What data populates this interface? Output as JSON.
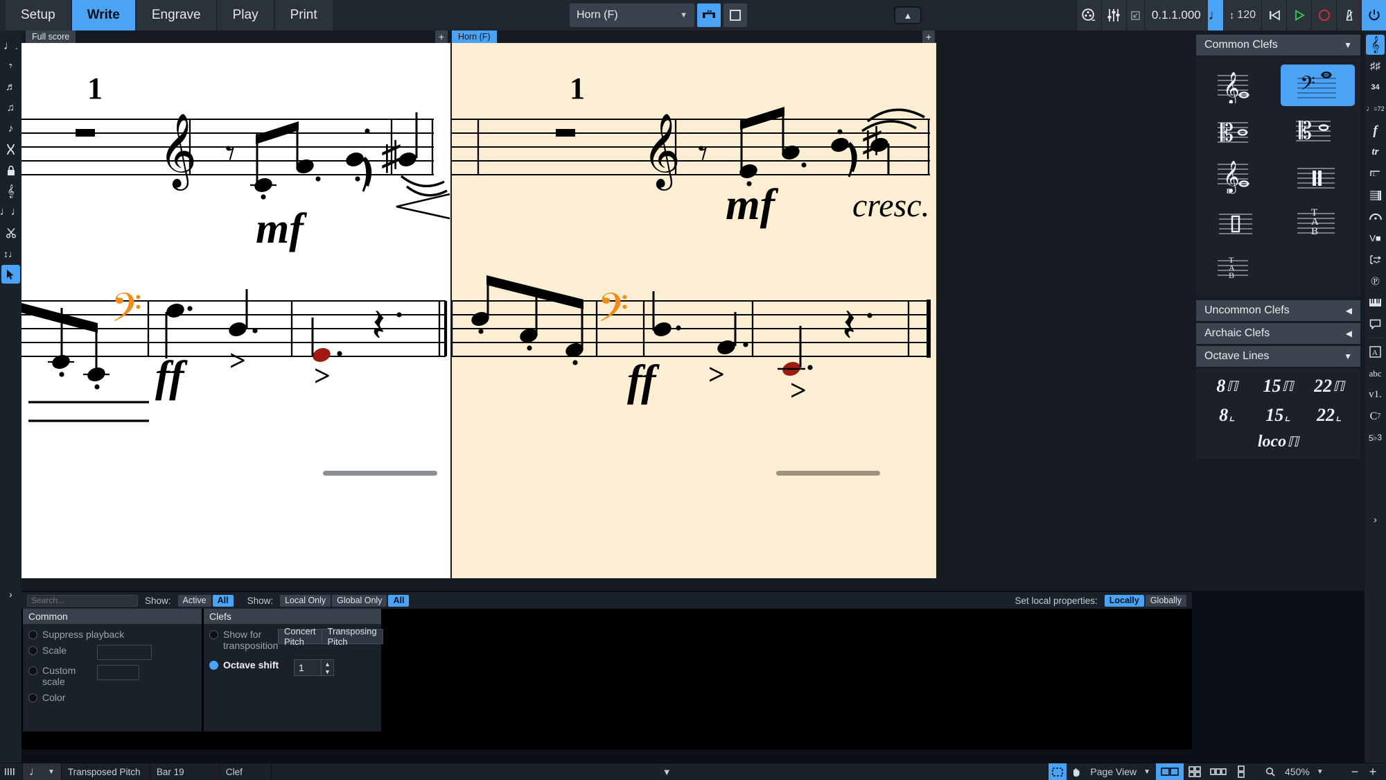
{
  "app": {
    "modes": [
      {
        "id": "setup",
        "label": "Setup",
        "active": false
      },
      {
        "id": "write",
        "label": "Write",
        "active": true
      },
      {
        "id": "engrave",
        "label": "Engrave",
        "active": false
      },
      {
        "id": "play",
        "label": "Play",
        "active": false
      },
      {
        "id": "print",
        "label": "Print",
        "active": false
      }
    ]
  },
  "toolbar": {
    "layout_select_value": "Horn (F)",
    "galley_view_icon": "galley-view-icon",
    "page_view_icon": "page-view-icon",
    "collapse_toolbar_icon": "chevron-up-icon",
    "mixer_icon": "mixer-icon",
    "video_icon": "film-reel-icon",
    "transport_position": "0.1.1.000",
    "tempo_note_icon": "quarter-note-icon",
    "tempo_value": "120",
    "rewind_icon": "rewind-to-start-icon",
    "play_icon": "play-icon",
    "record_icon": "record-icon",
    "metronome_icon": "metronome-icon",
    "power_icon": "power-icon"
  },
  "left_toolbar": {
    "items": [
      {
        "id": "note-durations",
        "icon": "dotted-quarter-note-icon",
        "active": false
      },
      {
        "id": "rests",
        "icon": "eighth-rest-icon",
        "active": false
      },
      {
        "id": "note-tools",
        "icon": "grace-note-icon",
        "active": false
      },
      {
        "id": "tuplets",
        "icon": "tuplet-icon",
        "active": false
      },
      {
        "id": "ornaments",
        "icon": "ornament-note-icon",
        "active": false
      },
      {
        "id": "slur-tool",
        "icon": "hourglass-icon",
        "active": false
      },
      {
        "id": "lock-duration",
        "icon": "lock-icon",
        "active": false
      },
      {
        "id": "insert-mode",
        "icon": "insert-clef-icon",
        "active": false
      },
      {
        "id": "rhythmic-grid",
        "icon": "two-notes-icon",
        "active": false
      },
      {
        "id": "cut-tool",
        "icon": "scissors-icon",
        "active": false
      },
      {
        "id": "transpose-tool",
        "icon": "transpose-note-icon",
        "active": false
      },
      {
        "id": "select-tool",
        "icon": "arrow-cursor-icon",
        "active": true
      }
    ],
    "expand_icon": "chevron-right-icon"
  },
  "right_toolbar": {
    "items": [
      {
        "id": "clefs-panel",
        "icon": "treble-clef-icon",
        "active": true
      },
      {
        "id": "key-signatures-panel",
        "icon": "double-sharp-icon",
        "active": false
      },
      {
        "id": "time-signatures-panel",
        "icon": "time-signature-icon",
        "active": false
      },
      {
        "id": "tempo-panel",
        "icon": "tempo-mark-icon",
        "active": false
      },
      {
        "id": "dynamics-panel",
        "icon": "forte-icon",
        "active": false
      },
      {
        "id": "ornaments-panel",
        "icon": "trill-icon",
        "active": false
      },
      {
        "id": "repeats-panel",
        "icon": "first-ending-icon",
        "active": false
      },
      {
        "id": "barlines-panel",
        "icon": "barlines-icon",
        "active": false
      },
      {
        "id": "holds-pauses-panel",
        "icon": "fermata-icon",
        "active": false
      },
      {
        "id": "playing-techniques-panel",
        "icon": "bowing-icon",
        "active": false
      },
      {
        "id": "lines-panel",
        "icon": "line-icon",
        "active": false
      },
      {
        "id": "pedal-lines-panel",
        "icon": "pedal-icon",
        "active": false
      },
      {
        "id": "tracks-panel",
        "icon": "keyboard-icon",
        "active": false
      },
      {
        "id": "comments-panel",
        "icon": "comment-icon",
        "active": false
      },
      {
        "id": "text-panel",
        "icon": "boxed-a-icon",
        "active": false
      },
      {
        "id": "lyrics-panel",
        "icon": "abc-icon",
        "active": false
      },
      {
        "id": "voices-panel",
        "icon": "v1-icon",
        "active": false
      },
      {
        "id": "chord-symbols-panel",
        "icon": "c7-icon",
        "active": false
      },
      {
        "id": "figured-bass-panel",
        "icon": "figured-bass-icon",
        "active": false
      }
    ]
  },
  "tabs": {
    "left": {
      "label": "Full score",
      "active": false
    },
    "right": {
      "label": "Horn (F)",
      "active": true
    },
    "add_label": "+"
  },
  "score": {
    "left_page": {
      "bar_number": "1",
      "systems": [
        {
          "clef": "treble",
          "dynamics": "mf",
          "marks": [
            "bar-rest",
            "eighth-rest",
            "hairpin-crescendo",
            "slur",
            "sharp"
          ]
        },
        {
          "clef": "bass",
          "clef_color": "#f28c18",
          "dynamics": "ff",
          "accent_marks": ">",
          "selected_note_color": "#9e1b14"
        }
      ]
    },
    "right_page": {
      "bar_number": "1",
      "systems": [
        {
          "clef": "treble",
          "dynamics": "mf",
          "text": "cresc.",
          "marks": [
            "bar-rest",
            "eighth-rest",
            "slur",
            "sharp"
          ]
        },
        {
          "clef": "bass",
          "clef_color": "#f28c18",
          "dynamics": "ff",
          "accent_marks": ">",
          "selected_note_color": "#9e1b14"
        }
      ]
    }
  },
  "right_panel": {
    "sections": [
      {
        "id": "common-clefs",
        "title": "Common Clefs",
        "expanded": true,
        "chevron": "chevron-down-icon"
      },
      {
        "id": "uncommon-clefs",
        "title": "Uncommon Clefs",
        "expanded": false,
        "chevron": "chevron-left-icon"
      },
      {
        "id": "archaic-clefs",
        "title": "Archaic Clefs",
        "expanded": false,
        "chevron": "chevron-left-icon"
      },
      {
        "id": "octave-lines",
        "title": "Octave Lines",
        "expanded": true,
        "chevron": "chevron-down-icon"
      }
    ],
    "common_clefs": [
      {
        "id": "treble-clef",
        "name": "treble-clef-icon",
        "selected": false
      },
      {
        "id": "bass-clef",
        "name": "bass-clef-icon",
        "selected": true
      },
      {
        "id": "alto-clef",
        "name": "alto-clef-icon",
        "selected": false
      },
      {
        "id": "tenor-clef",
        "name": "tenor-clef-icon",
        "selected": false
      },
      {
        "id": "treble-8vb-clef",
        "name": "treble-octave-down-clef-icon",
        "selected": false
      },
      {
        "id": "percussion-clef",
        "name": "percussion-clef-icon",
        "selected": false
      },
      {
        "id": "unpitched-percussion-clef",
        "name": "unpitched-percussion-clef-icon",
        "selected": false
      },
      {
        "id": "tab-clef-6",
        "name": "tab-clef-icon",
        "selected": false
      },
      {
        "id": "tab-clef-4",
        "name": "tab-clef-small-icon",
        "selected": false
      }
    ],
    "octave_lines": [
      {
        "id": "8va",
        "label": "8",
        "bracket": "up"
      },
      {
        "id": "15ma",
        "label": "15",
        "bracket": "up"
      },
      {
        "id": "22ma",
        "label": "22",
        "bracket": "up"
      },
      {
        "id": "8vb",
        "label": "8",
        "bracket": "down"
      },
      {
        "id": "15mb",
        "label": "15",
        "bracket": "down"
      },
      {
        "id": "22mb",
        "label": "22",
        "bracket": "down"
      },
      {
        "id": "loco",
        "label": "loco",
        "bracket": "up"
      }
    ]
  },
  "properties": {
    "search_placeholder": "Search...",
    "show_label_1": "Show:",
    "show_1": [
      {
        "label": "Active",
        "on": false
      },
      {
        "label": "All",
        "on": true
      }
    ],
    "show_label_2": "Show:",
    "show_2": [
      {
        "label": "Local Only",
        "on": false
      },
      {
        "label": "Global Only",
        "on": false
      },
      {
        "label": "All",
        "on": true
      }
    ],
    "set_local_label": "Set local properties:",
    "set_local": [
      {
        "label": "Locally",
        "on": true
      },
      {
        "label": "Globally",
        "on": false
      }
    ],
    "groups": [
      {
        "id": "common",
        "title": "Common",
        "rows": [
          {
            "id": "suppress-playback",
            "label": "Suppress playback",
            "enabled": false,
            "control": "none"
          },
          {
            "id": "scale",
            "label": "Scale",
            "enabled": false,
            "control": "field",
            "width": 100
          },
          {
            "id": "custom-scale",
            "label": "Custom scale",
            "enabled": false,
            "control": "field",
            "width": 63
          },
          {
            "id": "color",
            "label": "Color",
            "enabled": false,
            "control": "none"
          }
        ]
      },
      {
        "id": "clefs",
        "title": "Clefs",
        "rows": [
          {
            "id": "show-for-transposition",
            "label": "Show for transposition",
            "enabled": false,
            "control": "buttons",
            "buttons": [
              {
                "label": "Concert Pitch",
                "on": false
              },
              {
                "label": "Transposing Pitch",
                "on": false
              }
            ]
          },
          {
            "id": "octave-shift",
            "label": "Octave shift",
            "enabled": true,
            "control": "stepper",
            "value": "1"
          }
        ]
      }
    ]
  },
  "statusbar": {
    "voice_icon": "voice-columns-icon",
    "note_icon": "quarter-note-icon",
    "note_chevron": "chevron-down-icon",
    "pitch_mode": "Transposed Pitch",
    "bar": "Bar 19",
    "item": "Clef",
    "center_chevron": "chevron-down-icon",
    "marquee_icon": "marquee-select-icon",
    "hand_icon": "hand-pan-icon",
    "view_mode": "Page View",
    "view_chevron": "chevron-down-icon",
    "spread_icons": [
      {
        "id": "spreads-view",
        "icon": "two-page-spread-icon",
        "on": true
      },
      {
        "id": "pages-view",
        "icon": "four-page-grid-icon",
        "on": false
      },
      {
        "id": "horizontal-view",
        "icon": "three-page-row-icon",
        "on": false
      },
      {
        "id": "vertical-view",
        "icon": "two-page-column-icon",
        "on": false
      }
    ],
    "zoom_icon": "magnifier-icon",
    "zoom_value": "450%",
    "zoom_out": "−",
    "zoom_in": "+"
  },
  "colors": {
    "accent": "#4aa3f5",
    "panel_bg": "#1b212a",
    "toolbar_bg": "#20262f",
    "page_left_bg": "#ffffff",
    "page_right_bg": "#fbeed2",
    "selected_clef_orange": "#f28c18",
    "selected_note_red": "#9e1b14"
  }
}
